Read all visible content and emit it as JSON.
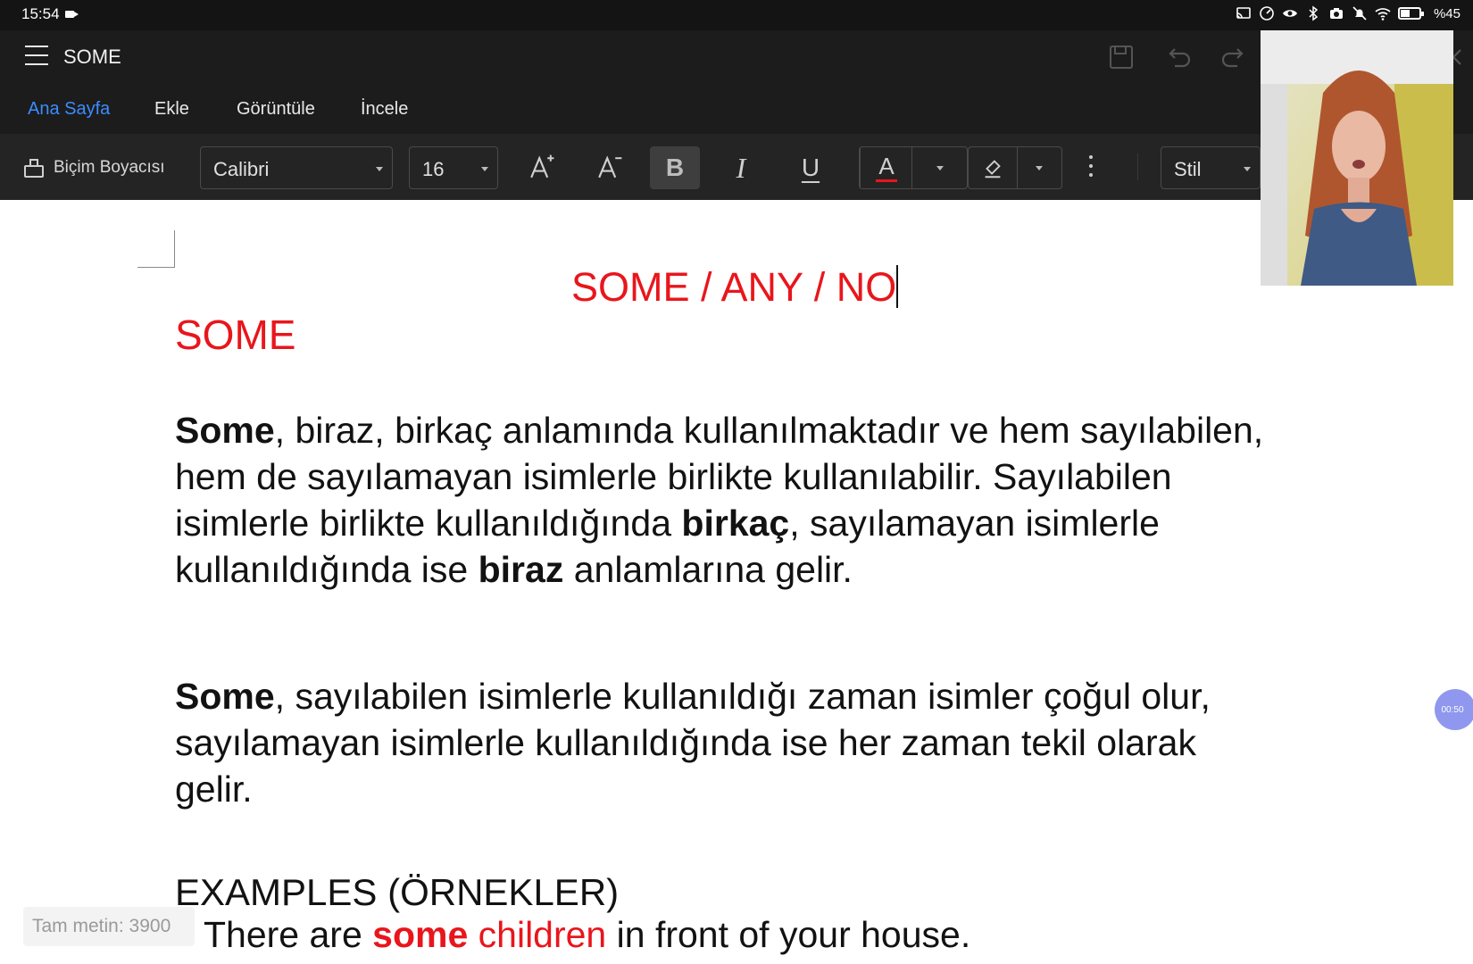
{
  "status_bar": {
    "time": "15:54",
    "battery": "%45",
    "icons": [
      "cast-icon",
      "speed-icon",
      "eye-icon",
      "bluetooth-icon",
      "camera-icon",
      "bell-off-icon",
      "wifi-icon",
      "battery-icon"
    ]
  },
  "title_bar": {
    "title": "SOME",
    "icons": [
      "menu-icon",
      "save-icon",
      "undo-icon",
      "redo-icon",
      "close-icon"
    ]
  },
  "tabs": [
    {
      "label": "Ana Sayfa",
      "active": true
    },
    {
      "label": "Ekle",
      "active": false
    },
    {
      "label": "Görüntüle",
      "active": false
    },
    {
      "label": "İncele",
      "active": false
    }
  ],
  "toolbar": {
    "format_painter": "Biçim Boyacısı",
    "font": "Calibri",
    "size": "16",
    "style": "Stil",
    "bold_glyph": "B",
    "italic_glyph": "I",
    "underline_glyph": "U",
    "font_color_glyph": "A",
    "font_color": "#e8161c"
  },
  "document": {
    "title": "SOME / ANY / NO",
    "heading": "SOME",
    "para1": {
      "b1": "Some",
      "t1": ", biraz, birkaç anlamında kullanılmaktadır ve hem sayılabilen, hem de sayılamayan isimlerle birlikte kullanılabilir. Sayılabilen isimlerle birlikte kullanıldığında ",
      "b2": "birkaç",
      "t2": ", sayılamayan isimlerle kullanıldığında ise ",
      "b3": "biraz",
      "t3": " anlamlarına gelir."
    },
    "para2": {
      "b1": "Some",
      "t1": ", sayılabilen isimlerle kullanıldığı zaman isimler çoğul olur, sayılamayan isimlerle kullanıldığında ise her zaman tekil olarak gelir."
    },
    "examples_heading": "EXAMPLES (ÖRNEKLER)",
    "example1": {
      "pre": "There are ",
      "some": "some",
      "noun": " children",
      "post": " in front of your house."
    }
  },
  "word_count": "Tam metin: 3900",
  "timer": "00:50",
  "accent_color": "#3b8cff",
  "highlight_red": "#e8161c"
}
